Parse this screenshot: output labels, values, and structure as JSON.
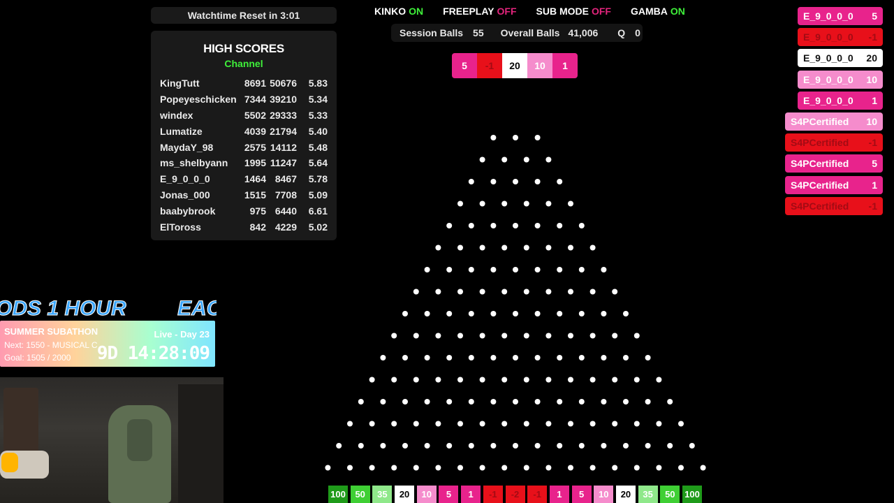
{
  "watchtime": {
    "label": "Watchtime Reset in 3:01"
  },
  "scores": {
    "title": "HIGH SCORES",
    "subtitle": "Channel",
    "rows": [
      {
        "name": "KingTutt",
        "a": "8691",
        "b": "50676",
        "c": "5.83"
      },
      {
        "name": "Popeyeschicken",
        "a": "7344",
        "b": "39210",
        "c": "5.34"
      },
      {
        "name": "windex",
        "a": "5502",
        "b": "29333",
        "c": "5.33"
      },
      {
        "name": "Lumatize",
        "a": "4039",
        "b": "21794",
        "c": "5.40"
      },
      {
        "name": "MaydaY_98",
        "a": "2575",
        "b": "14112",
        "c": "5.48"
      },
      {
        "name": "ms_shelbyann",
        "a": "1995",
        "b": "11247",
        "c": "5.64"
      },
      {
        "name": "E_9_0_0_0",
        "a": "1464",
        "b": "8467",
        "c": "5.78"
      },
      {
        "name": "Jonas_000",
        "a": "1515",
        "b": "7708",
        "c": "5.09"
      },
      {
        "name": "baabybrook",
        "a": "975",
        "b": "6440",
        "c": "6.61"
      },
      {
        "name": "ElToross",
        "a": "842",
        "b": "4229",
        "c": "5.02"
      }
    ]
  },
  "toggles": [
    {
      "label": "KINKO",
      "value": "ON",
      "color": "#3ff03a"
    },
    {
      "label": "FREEPLAY",
      "value": "OFF",
      "color": "#e3247d"
    },
    {
      "label": "SUB MODE",
      "value": "OFF",
      "color": "#e3247d"
    },
    {
      "label": "GAMBA",
      "value": "ON",
      "color": "#3ff03a"
    }
  ],
  "stats": {
    "session_label": "Session Balls",
    "session_value": "55",
    "overall_label": "Overall Balls",
    "overall_value": "41,006",
    "queue_label": "Q",
    "queue_value": "0"
  },
  "recent": [
    {
      "value": "5",
      "bg": "#e8238c",
      "fg": "#ffffff"
    },
    {
      "value": "-1",
      "bg": "#e8101a",
      "fg": "#a30b14"
    },
    {
      "value": "20",
      "bg": "#ffffff",
      "fg": "#000000"
    },
    {
      "value": "10",
      "bg": "#f58ccc",
      "fg": "#ffffff"
    },
    {
      "value": "1",
      "bg": "#e8238c",
      "fg": "#ffffff"
    }
  ],
  "feed": [
    {
      "name": "E_9_0_0_0",
      "value": "5",
      "bg": "#e8238c",
      "fg": "#ffffff"
    },
    {
      "name": "E_9_0_0_0",
      "value": "-1",
      "bg": "#e8101a",
      "fg": "#a30b14"
    },
    {
      "name": "E_9_0_0_0",
      "value": "20",
      "bg": "#ffffff",
      "fg": "#111111"
    },
    {
      "name": "E_9_0_0_0",
      "value": "10",
      "bg": "#f58ccc",
      "fg": "#ffffff"
    },
    {
      "name": "E_9_0_0_0",
      "value": "1",
      "bg": "#e8238c",
      "fg": "#ffffff"
    },
    {
      "name": "S4PCertified",
      "value": "10",
      "bg": "#f58ccc",
      "fg": "#ffffff"
    },
    {
      "name": "S4PCertified",
      "value": "-1",
      "bg": "#e8101a",
      "fg": "#a30b14"
    },
    {
      "name": "S4PCertified",
      "value": "5",
      "bg": "#e8238c",
      "fg": "#ffffff"
    },
    {
      "name": "S4PCertified",
      "value": "1",
      "bg": "#e8238c",
      "fg": "#ffffff"
    },
    {
      "name": "S4PCertified",
      "value": "-1",
      "bg": "#e8101a",
      "fg": "#a30b14"
    }
  ],
  "slots": [
    {
      "value": "100",
      "bg": "#1f9b1a",
      "fg": "#ffffff"
    },
    {
      "value": "50",
      "bg": "#3fcf34",
      "fg": "#ffffff"
    },
    {
      "value": "35",
      "bg": "#8fe88a",
      "fg": "#ffffff"
    },
    {
      "value": "20",
      "bg": "#ffffff",
      "fg": "#000000"
    },
    {
      "value": "10",
      "bg": "#f58ccc",
      "fg": "#ffffff"
    },
    {
      "value": "5",
      "bg": "#e8238c",
      "fg": "#ffffff"
    },
    {
      "value": "1",
      "bg": "#e8238c",
      "fg": "#ffffff"
    },
    {
      "value": "-1",
      "bg": "#e8101a",
      "fg": "#a30b14"
    },
    {
      "value": "-2",
      "bg": "#e8101a",
      "fg": "#a30b14"
    },
    {
      "value": "-1",
      "bg": "#e8101a",
      "fg": "#a30b14"
    },
    {
      "value": "1",
      "bg": "#e8238c",
      "fg": "#ffffff"
    },
    {
      "value": "5",
      "bg": "#e8238c",
      "fg": "#ffffff"
    },
    {
      "value": "10",
      "bg": "#f58ccc",
      "fg": "#ffffff"
    },
    {
      "value": "20",
      "bg": "#ffffff",
      "fg": "#000000"
    },
    {
      "value": "35",
      "bg": "#8fe88a",
      "fg": "#ffffff"
    },
    {
      "value": "50",
      "bg": "#3fcf34",
      "fg": "#ffffff"
    },
    {
      "value": "100",
      "bg": "#1f9b1a",
      "fg": "#ffffff"
    }
  ],
  "subathon": {
    "ticker_left": "ODS 1 HOUR",
    "ticker_right": "EAC",
    "title": "SUMMER SUBATHON",
    "next": "Next: 1550 - MUSICAL C",
    "goal": "Goal: 1505 / 2000",
    "live": "Live - Day 23",
    "timer": "9D 14:28:09"
  }
}
